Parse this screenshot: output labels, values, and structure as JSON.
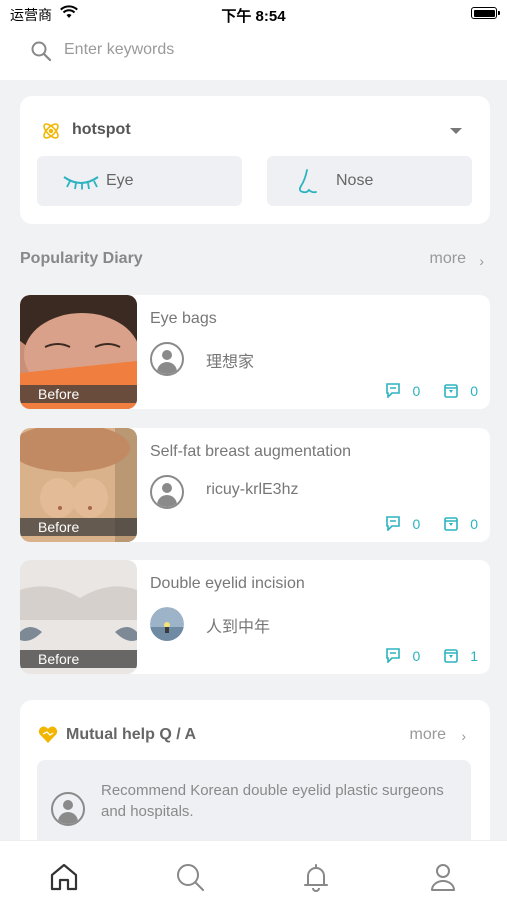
{
  "status": {
    "carrier": "运营商",
    "time": "下午 8:54"
  },
  "search": {
    "placeholder": "Enter keywords"
  },
  "hotspot": {
    "title": "hotspot",
    "chips": [
      {
        "label": "Eye",
        "icon": "eyelash-icon"
      },
      {
        "label": "Nose",
        "icon": "nose-icon"
      }
    ]
  },
  "popularity": {
    "title": "Popularity Diary",
    "more": "more",
    "items": [
      {
        "title": "Eye bags",
        "author": "理想家",
        "badge": "Before",
        "comments": "0",
        "favorites": "0"
      },
      {
        "title": "Self-fat breast augmentation",
        "author": "ricuy-krlE3hz",
        "badge": "Before",
        "comments": "0",
        "favorites": "0"
      },
      {
        "title": "Double eyelid incision",
        "author": "人到中年",
        "badge": "Before",
        "comments": "0",
        "favorites": "1"
      }
    ]
  },
  "qa": {
    "title": "Mutual help Q / A",
    "more": "more",
    "items": [
      {
        "text": "Recommend Korean double eyelid plastic surgeons and hospitals."
      }
    ]
  },
  "tabbar": {
    "items": [
      "home-icon",
      "search-icon",
      "bell-icon",
      "profile-icon"
    ]
  },
  "colors": {
    "accent": "#2bb3c0",
    "background": "#f1f2f4",
    "hot_icon": "#f2b600"
  }
}
